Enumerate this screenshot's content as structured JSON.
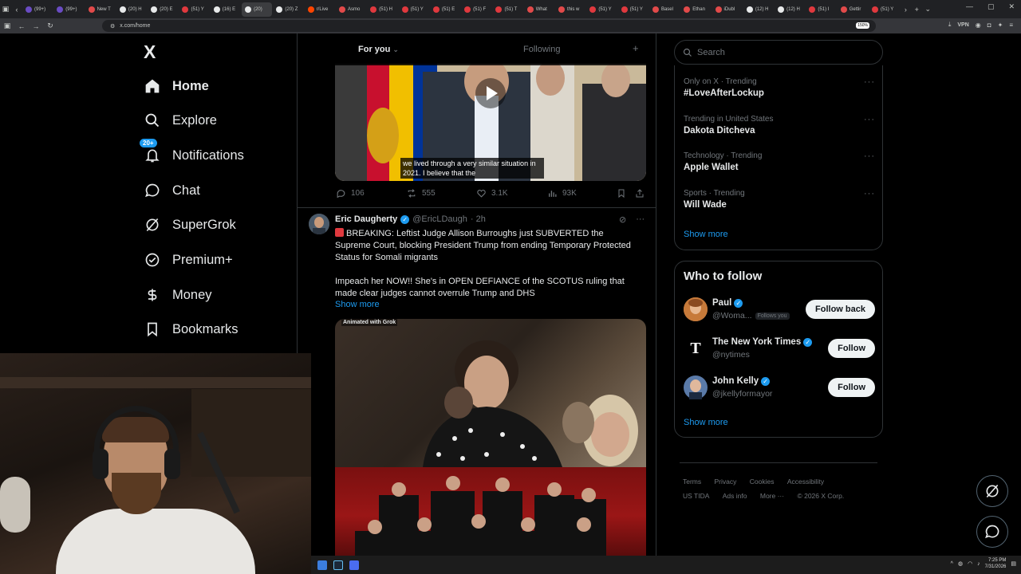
{
  "browser": {
    "tabs": [
      {
        "title": "(99+)",
        "color": "#6a4cc4"
      },
      {
        "title": "(99+)",
        "color": "#6a4cc4"
      },
      {
        "title": "New T",
        "color": "#e24a4a"
      },
      {
        "title": "(20) H",
        "color": "#e7e9ea"
      },
      {
        "title": "(20) E",
        "color": "#e7e9ea"
      },
      {
        "title": "(51) Y",
        "color": "#e0393e"
      },
      {
        "title": "(16) E",
        "color": "#e7e9ea"
      },
      {
        "title": "(20)",
        "color": "#e7e9ea",
        "active": true
      },
      {
        "title": "(20) Z",
        "color": "#e7e9ea"
      },
      {
        "title": "r/Live",
        "color": "#ff4500"
      },
      {
        "title": "Asmo",
        "color": "#e24a4a"
      },
      {
        "title": "(51) H",
        "color": "#e0393e"
      },
      {
        "title": "(51) Y",
        "color": "#e0393e"
      },
      {
        "title": "(51) E",
        "color": "#e0393e"
      },
      {
        "title": "(51) F",
        "color": "#e0393e"
      },
      {
        "title": "(51) T",
        "color": "#e0393e"
      },
      {
        "title": "What",
        "color": "#e24a4a"
      },
      {
        "title": "this w",
        "color": "#e24a4a"
      },
      {
        "title": "(51) Y",
        "color": "#e0393e"
      },
      {
        "title": "(51) Y",
        "color": "#e0393e"
      },
      {
        "title": "Basel",
        "color": "#e24a4a"
      },
      {
        "title": "Ethan",
        "color": "#e24a4a"
      },
      {
        "title": "iDubl",
        "color": "#e24a4a"
      },
      {
        "title": "(12) H",
        "color": "#e7e9ea"
      },
      {
        "title": "(12) H",
        "color": "#e7e9ea"
      },
      {
        "title": "(51) I",
        "color": "#e0393e"
      },
      {
        "title": "Gettir",
        "color": "#e24a4a"
      },
      {
        "title": "(51) Y",
        "color": "#e0393e"
      }
    ],
    "url": "x.com/home",
    "zoom": "150%",
    "vpn_label": "VPN"
  },
  "nav": {
    "logo": "X",
    "items": [
      {
        "label": "Home",
        "icon": "home-icon",
        "bold": true
      },
      {
        "label": "Explore",
        "icon": "search-icon"
      },
      {
        "label": "Notifications",
        "icon": "bell-icon",
        "badge": "20+"
      },
      {
        "label": "Chat",
        "icon": "chat-icon"
      },
      {
        "label": "SuperGrok",
        "icon": "grok-icon"
      },
      {
        "label": "Premium+",
        "icon": "premium-icon"
      },
      {
        "label": "Money",
        "icon": "money-icon"
      },
      {
        "label": "Bookmarks",
        "icon": "bookmark-icon"
      }
    ]
  },
  "timeline": {
    "tab_for_you": "For you",
    "tab_following": "Following",
    "add_tab": "+",
    "video_caption": "we lived through a very similar situation in 2021. I believe that the",
    "prev_post_actions": {
      "replies": "106",
      "reposts": "555",
      "likes": "3.1K",
      "views": "93K"
    },
    "post": {
      "author": "Eric Daugherty",
      "handle": "@EricLDaugh",
      "time": "· 2h",
      "paragraph1": "BREAKING: Leftist Judge Allison Burroughs just SUBVERTED the Supreme Court, blocking President Trump from ending Temporary Protected Status for Somali migrants",
      "paragraph2": "Impeach her NOW!! She's in OPEN DEFIANCE of the SCOTUS ruling that made clear judges cannot overrule Trump and DHS",
      "show_more": "Show more",
      "media_label": "Animated with Grok"
    }
  },
  "sidebar": {
    "search_placeholder": "Search",
    "trends": [
      {
        "context": "Only on X · Trending",
        "name": "#LoveAfterLockup"
      },
      {
        "context": "Trending in United States",
        "name": "Dakota Ditcheva"
      },
      {
        "context": "Technology · Trending",
        "name": "Apple Wallet"
      },
      {
        "context": "Sports · Trending",
        "name": "Will Wade"
      }
    ],
    "trends_show_more": "Show more",
    "who_to_follow_title": "Who to follow",
    "follow_suggestions": [
      {
        "name": "Paul",
        "handle": "@Woma...",
        "follows_you": "Follows you",
        "button": "Follow back",
        "avatar_color": "#d08a4a",
        "avatar_text": ""
      },
      {
        "name": "The New York Times",
        "handle": "@nytimes",
        "button": "Follow",
        "avatar_color": "#ffffff",
        "avatar_text": "T"
      },
      {
        "name": "John Kelly",
        "handle": "@jkellyformayor",
        "button": "Follow",
        "avatar_color": "#5a7aa8",
        "avatar_text": ""
      }
    ],
    "wtf_show_more": "Show more",
    "footer_links": [
      "Terms",
      "Privacy",
      "Cookies",
      "Accessibility",
      "US TIDA",
      "Ads info",
      "More ···",
      "© 2026 X Corp."
    ]
  },
  "taskbar": {
    "time": "7:25 PM",
    "date": "7/31/2026"
  },
  "colors": {
    "accent": "#1d9bf0",
    "background": "#000000",
    "border": "#2f3336",
    "muted_text": "#71767b"
  }
}
